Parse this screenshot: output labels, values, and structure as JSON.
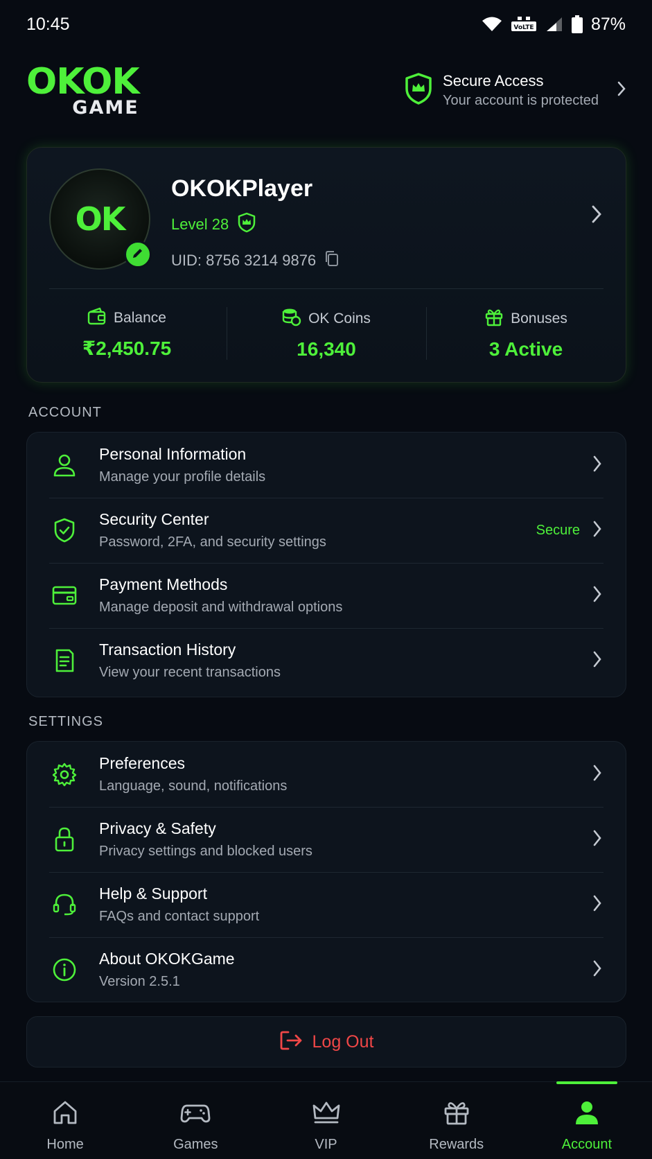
{
  "status_bar": {
    "time": "10:45",
    "battery": "87%",
    "network_label": "VoLTE",
    "icons": [
      "wifi-icon",
      "volte-icon",
      "signal-icon",
      "battery-icon"
    ]
  },
  "header": {
    "logo_top": "OKOK",
    "logo_bottom": "GAME",
    "secure_title": "Secure Access",
    "secure_subtitle": "Your account is protected"
  },
  "profile": {
    "avatar_text": "OK",
    "username": "OKOKPlayer",
    "level": "Level 28",
    "uid": "UID: 8756 3214 9876",
    "stats": [
      {
        "label": "Balance",
        "value": "₹2,450.75",
        "icon": "wallet-icon"
      },
      {
        "label": "OK Coins",
        "value": "16,340",
        "icon": "coins-icon"
      },
      {
        "label": "Bonuses",
        "value": "3 Active",
        "icon": "gift-icon"
      }
    ]
  },
  "account_section": {
    "title": "ACCOUNT",
    "items": [
      {
        "title": "Personal Information",
        "subtitle": "Manage your profile details",
        "icon": "user-icon"
      },
      {
        "title": "Security Center",
        "subtitle": "Password, 2FA, and security settings",
        "badge": "Secure",
        "icon": "shield-check-icon"
      },
      {
        "title": "Payment Methods",
        "subtitle": "Manage deposit and withdrawal options",
        "icon": "card-icon"
      },
      {
        "title": "Transaction History",
        "subtitle": "View your recent transactions",
        "icon": "receipt-icon"
      }
    ]
  },
  "settings_section": {
    "title": "SETTINGS",
    "items": [
      {
        "title": "Preferences",
        "subtitle": "Language, sound, notifications",
        "icon": "gear-icon"
      },
      {
        "title": "Privacy & Safety",
        "subtitle": "Privacy settings and blocked users",
        "icon": "lock-icon"
      },
      {
        "title": "Help & Support",
        "subtitle": "FAQs and contact support",
        "icon": "headset-icon"
      },
      {
        "title": "About OKOKGame",
        "subtitle": "Version 2.5.1",
        "icon": "info-icon"
      }
    ]
  },
  "logout_label": "Log Out",
  "tabs": [
    {
      "label": "Home",
      "icon": "home-icon",
      "active": false
    },
    {
      "label": "Games",
      "icon": "gamepad-icon",
      "active": false
    },
    {
      "label": "VIP",
      "icon": "crown-icon",
      "active": false
    },
    {
      "label": "Rewards",
      "icon": "gift-icon",
      "active": false
    },
    {
      "label": "Account",
      "icon": "user-icon",
      "active": true
    }
  ],
  "colors": {
    "background": "#070b12",
    "accent": "#4ef03a",
    "danger": "#f04747",
    "card": "#0d141d"
  }
}
